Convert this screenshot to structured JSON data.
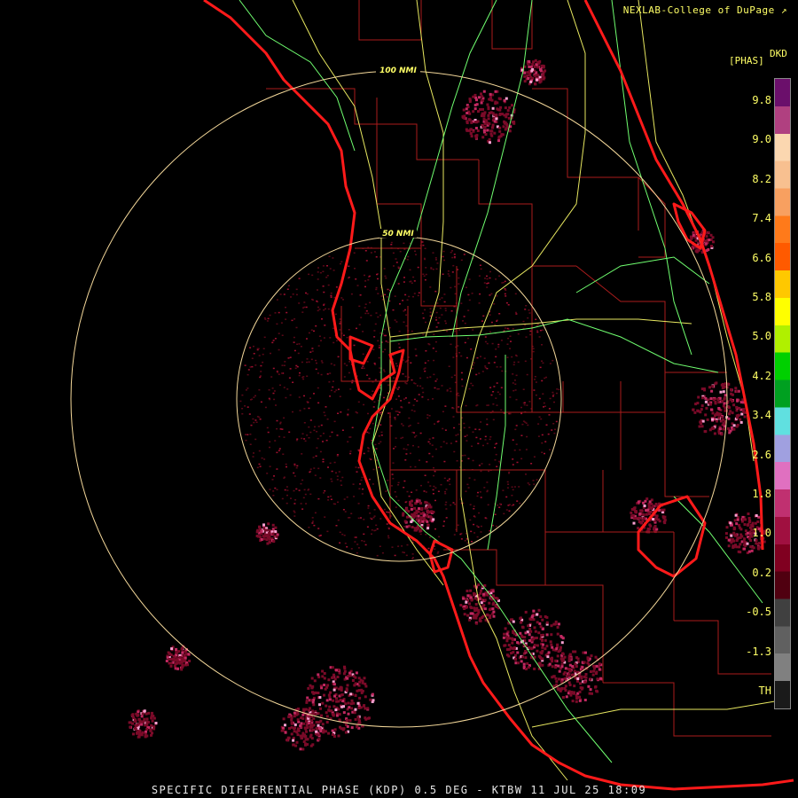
{
  "credit": "NEXLAB-College of DuPage",
  "credit_icon": "external-link-icon",
  "legend": {
    "code": "DKD",
    "unit": "[PHAS]",
    "ticks": [
      "9.8",
      "9.0",
      "8.2",
      "7.4",
      "6.6",
      "5.8",
      "5.0",
      "4.2",
      "3.4",
      "2.6",
      "1.8",
      "1.0",
      "0.2",
      "-0.5",
      "-1.3",
      "TH"
    ],
    "colors": [
      "#6b0f6b",
      "#b04080",
      "#fbd7b0",
      "#f8c090",
      "#f8a060",
      "#ff7a1a",
      "#ff5a00",
      "#ffc800",
      "#ffff00",
      "#b0f000",
      "#00d000",
      "#00a020",
      "#60e0e0",
      "#a0a0e0",
      "#e070c0",
      "#c03070",
      "#a01040",
      "#800020",
      "#500010",
      "#404040",
      "#606060",
      "#808080",
      "#1a1a1a"
    ]
  },
  "range_rings": [
    "50 NMI",
    "100 NMI"
  ],
  "caption": "SPECIFIC DIFFERENTIAL PHASE (KDP) 0.5 DEG - KTBW 11 JUL 25 18:09",
  "colors": {
    "coastline": "#ff1a1a",
    "counties": "#aa1c1c",
    "highways": "#70ff70",
    "roads": "#e8e860",
    "rings": "#f4d89a",
    "echo": "#7a0a1e"
  }
}
